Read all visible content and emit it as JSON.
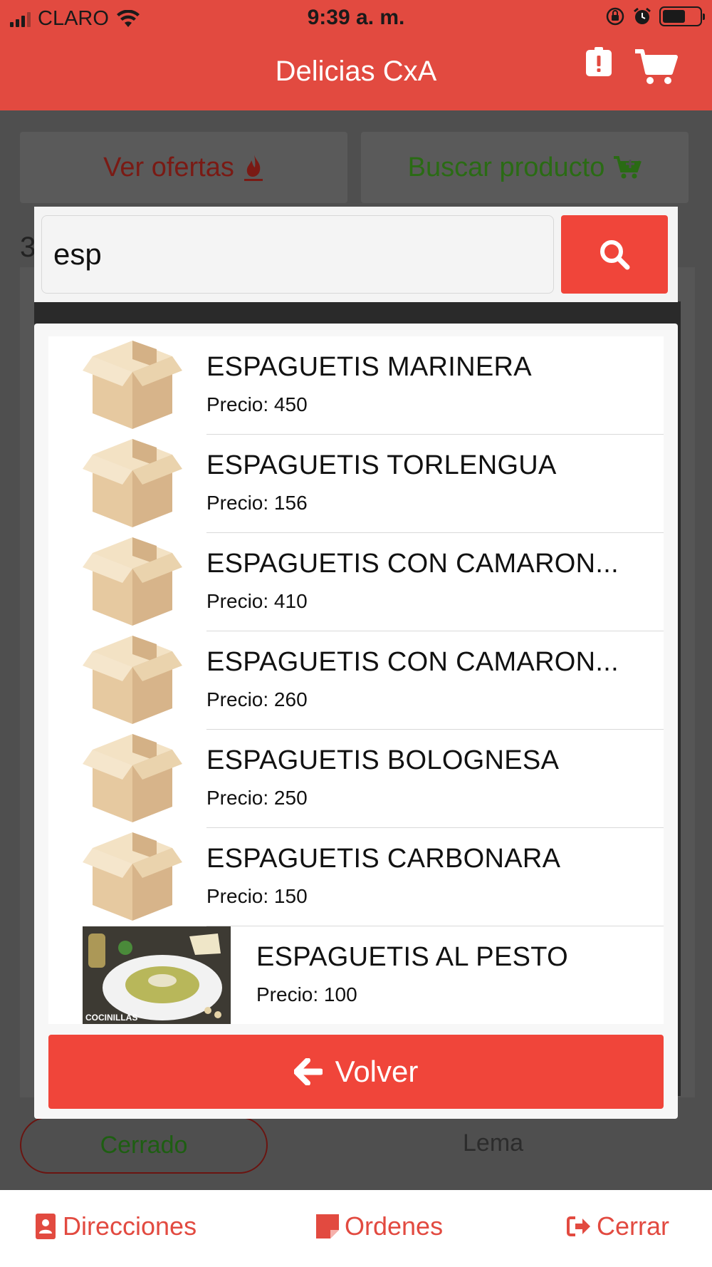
{
  "status_bar": {
    "carrier": "CLARO",
    "time": "9:39 a. m."
  },
  "header": {
    "title": "Delicias CxA",
    "icons": [
      "alert-icon",
      "cart-icon"
    ]
  },
  "background": {
    "tabs": {
      "offers_label": "Ver ofertas",
      "search_label": "Buscar producto"
    },
    "stub_text": "3",
    "status_label": "Cerrado",
    "slogan_label": "Lema"
  },
  "search": {
    "value": "esp",
    "button_icon": "search-icon"
  },
  "results": {
    "price_prefix": "Precio:",
    "items": [
      {
        "name": "ESPAGUETIS MARINERA",
        "price": "Precio: 450",
        "image": "box-icon"
      },
      {
        "name": "ESPAGUETIS TORLENGUA",
        "price": "Precio: 156",
        "image": "box-icon"
      },
      {
        "name": "ESPAGUETIS CON CAMARON...",
        "price": "Precio: 410",
        "image": "box-icon"
      },
      {
        "name": "ESPAGUETIS CON CAMARON...",
        "price": "Precio: 260",
        "image": "box-icon"
      },
      {
        "name": "ESPAGUETIS BOLOGNESA",
        "price": "Precio: 250",
        "image": "box-icon"
      },
      {
        "name": "ESPAGUETIS CARBONARA",
        "price": "Precio: 150",
        "image": "box-icon"
      },
      {
        "name": "ESPAGUETIS AL PESTO",
        "price": "Precio: 100",
        "image": "pesto-photo",
        "photo_caption": "COCINILLAS"
      }
    ],
    "back_label": "Volver"
  },
  "bottom_nav": {
    "addresses": "Direcciones",
    "orders": "Ordenes",
    "close": "Cerrar"
  },
  "colors": {
    "brand_red": "#e24a40",
    "button_red": "#f0453a",
    "overlay_gray": "#4f4f4f"
  }
}
